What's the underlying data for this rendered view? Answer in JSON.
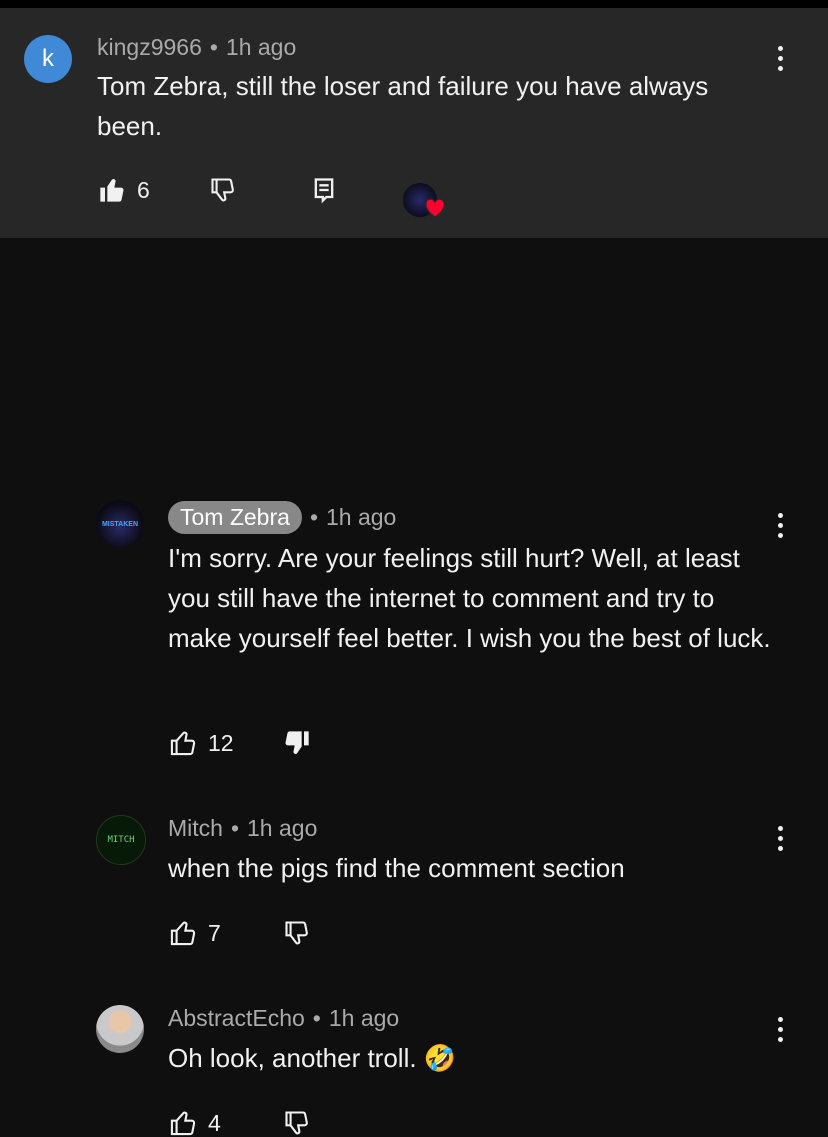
{
  "main": {
    "avatar_letter": "k",
    "author": "kingz9966",
    "separator": "•",
    "time": "1h ago",
    "text": "Tom Zebra, still the loser and failure you have always been.",
    "likes": "6",
    "hearted": true
  },
  "replies": [
    {
      "author": "Tom Zebra",
      "is_owner": true,
      "time": "1h ago",
      "avatar_text": "MISTAKEN",
      "text": "I'm sorry. Are your feelings still hurt? Well, at least you still have the internet to comment and try to make yourself feel better. I wish you the best of luck.",
      "likes": "12",
      "disliked": true
    },
    {
      "author": "Mitch",
      "time": "1h ago",
      "avatar_text": "MITCH",
      "text": "when the pigs find the comment section",
      "likes": "7"
    },
    {
      "author": "AbstractEcho",
      "time": "1h ago",
      "text": "Oh look, another troll. 🤣",
      "likes": "4"
    }
  ],
  "colors": {
    "background": "#0f0f0f",
    "highlight": "#272727",
    "owner_badge": "#888888",
    "heart": "#ff0033",
    "avatar_k": "#3f89d6"
  },
  "icons": {
    "like": "thumb-up-icon",
    "dislike": "thumb-down-icon",
    "reply": "reply-icon",
    "menu": "more-vert-icon",
    "heart": "heart-icon"
  }
}
